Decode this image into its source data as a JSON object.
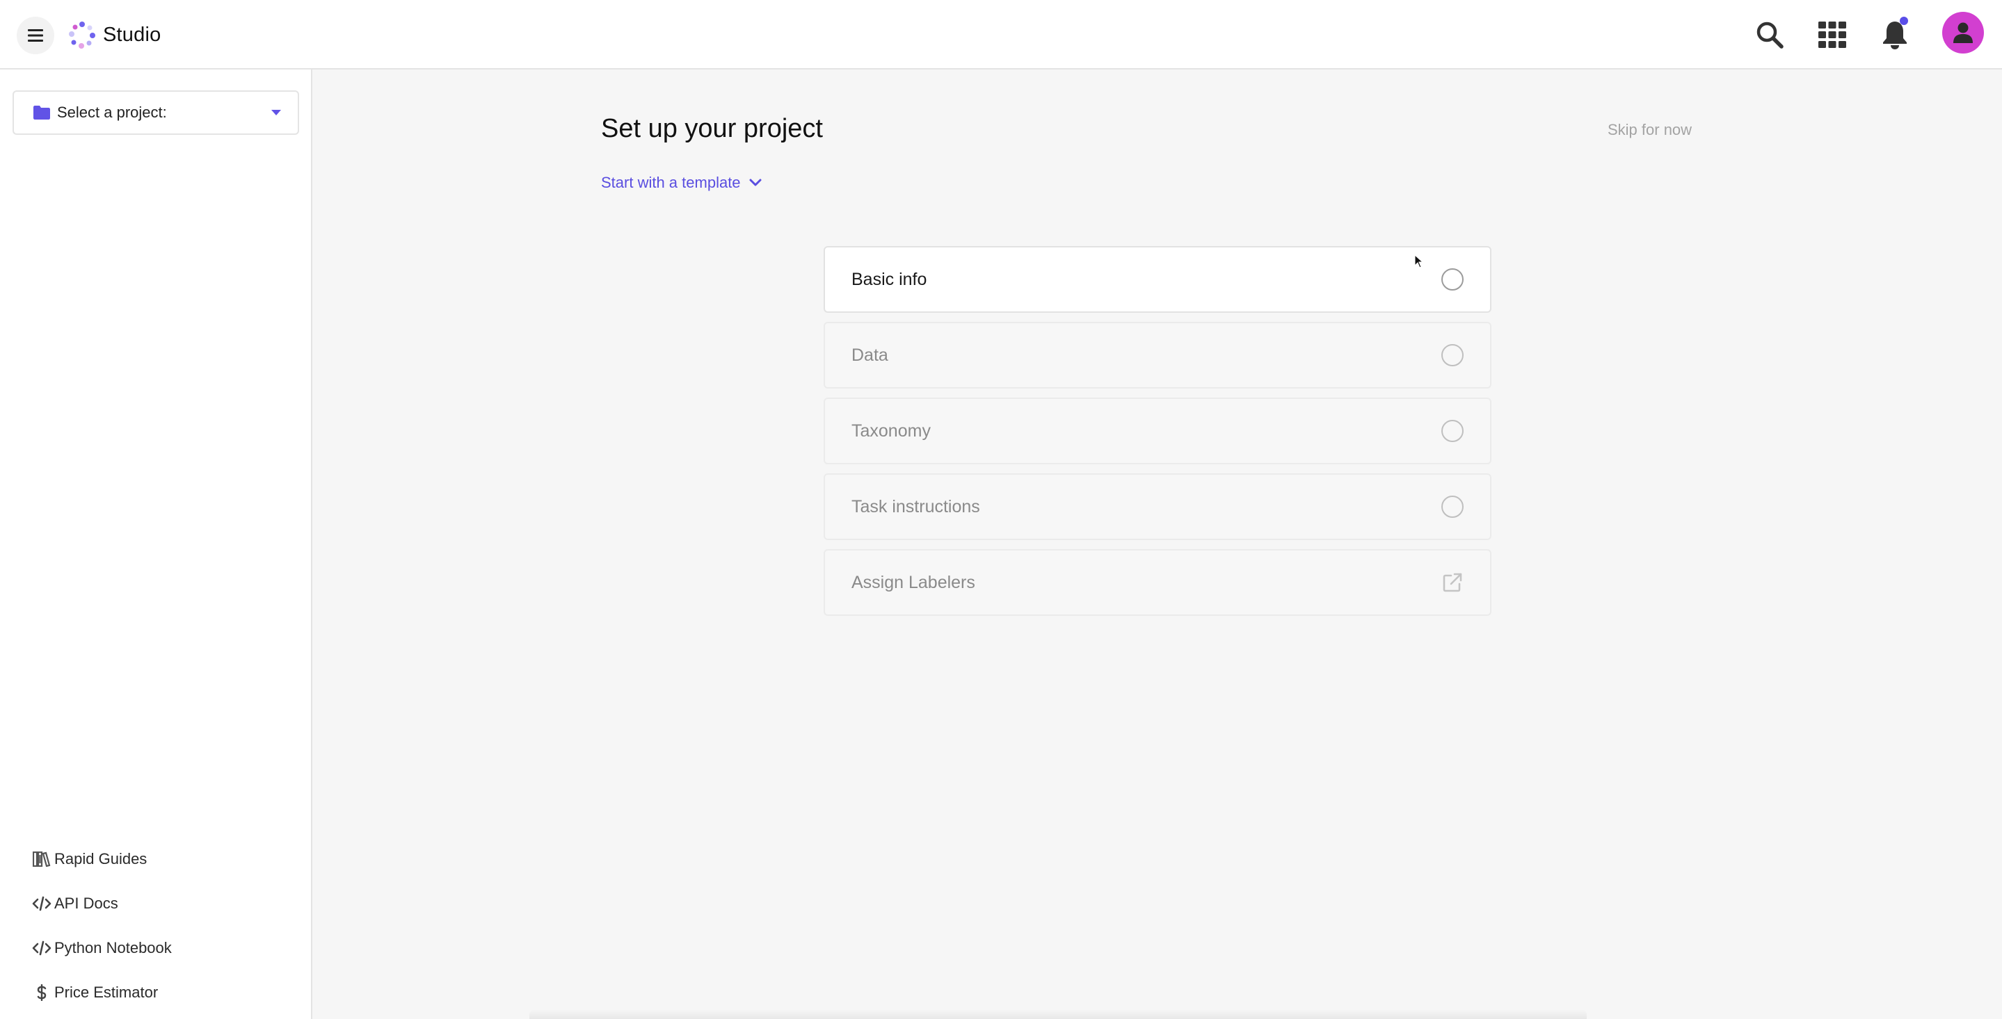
{
  "app": {
    "name": "Studio",
    "accent_color": "#5a4ee8",
    "avatar_color": "#d23fd0"
  },
  "topbar": {
    "menu_icon": "hamburger-icon",
    "logo_icon": "studio-logo",
    "icons": [
      "search-icon",
      "apps-grid-icon",
      "bell-icon",
      "user-avatar-icon"
    ],
    "notification_unread": true
  },
  "sidebar": {
    "project_select": {
      "label": "Select a project:",
      "icon": "folder-icon"
    },
    "links": [
      {
        "label": "Rapid Guides",
        "icon": "books-icon"
      },
      {
        "label": "API Docs",
        "icon": "code-icon"
      },
      {
        "label": "Python Notebook",
        "icon": "code-icon"
      },
      {
        "label": "Price Estimator",
        "icon": "dollar-icon"
      }
    ]
  },
  "main": {
    "title": "Set up your project",
    "skip_label": "Skip for now",
    "template_label": "Start with a template",
    "steps": [
      {
        "label": "Basic info",
        "state": "active",
        "indicator": "radio"
      },
      {
        "label": "Data",
        "state": "disabled",
        "indicator": "radio"
      },
      {
        "label": "Taxonomy",
        "state": "disabled",
        "indicator": "radio"
      },
      {
        "label": "Task instructions",
        "state": "disabled",
        "indicator": "radio"
      },
      {
        "label": "Assign Labelers",
        "state": "disabled",
        "indicator": "external-link"
      }
    ]
  }
}
